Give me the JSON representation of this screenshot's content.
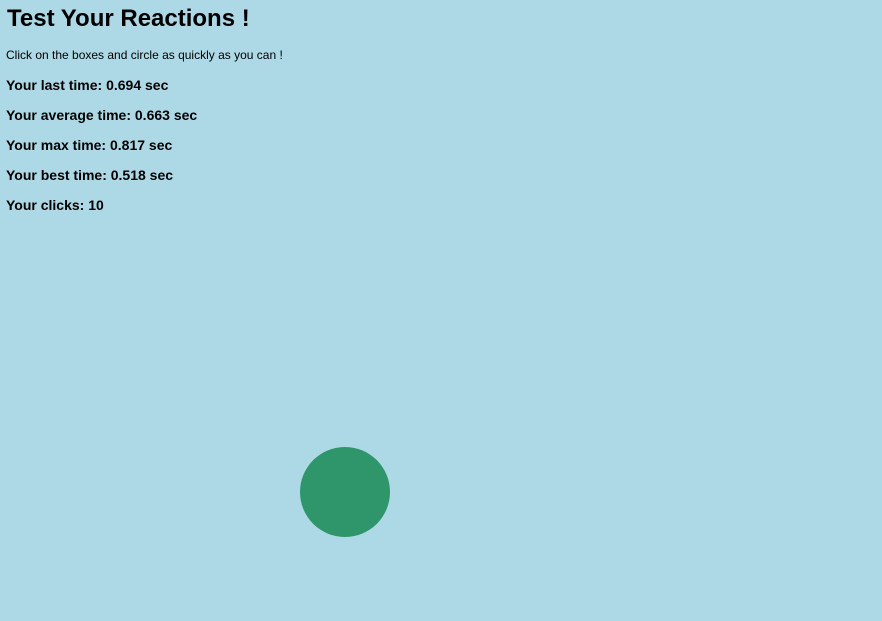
{
  "header": {
    "title": "Test Your Reactions !",
    "instructions": "Click on the boxes and circle as quickly as you can !"
  },
  "stats": {
    "last_time": "Your last time: 0.694 sec",
    "average_time": "Your average time: 0.663 sec",
    "max_time": "Your max time: 0.817 sec",
    "best_time": "Your best time: 0.518 sec",
    "clicks": "Your clicks: 10"
  },
  "target": {
    "shape": "circle",
    "color": "#2E966A"
  },
  "colors": {
    "background": "#ADD8E6"
  }
}
